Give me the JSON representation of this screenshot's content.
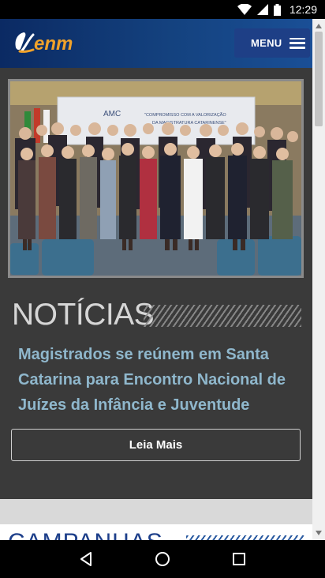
{
  "status_bar": {
    "time": "12:29"
  },
  "header": {
    "brand": "enm",
    "menu_label": "MENU"
  },
  "hero": {
    "banner_line1": "AMC",
    "banner_line2": "\"COMPROMISSO COM A VALORIZAÇÃO",
    "banner_line3": "DA MAGISTRATURA CATARINENSE\""
  },
  "news": {
    "heading": "NOTÍCIAS",
    "headline": "Magistrados se reúnem em Santa Catarina para Encontro Nacional de Juízes da Infância e Juventude",
    "read_more_label": "Leia Mais"
  },
  "campaigns": {
    "heading": "CAMPANHAS"
  },
  "colors": {
    "header": "#14427f",
    "menu_button": "#1e3f86",
    "headline": "#8fb7cc",
    "campaigns": "#1d3f8a"
  }
}
